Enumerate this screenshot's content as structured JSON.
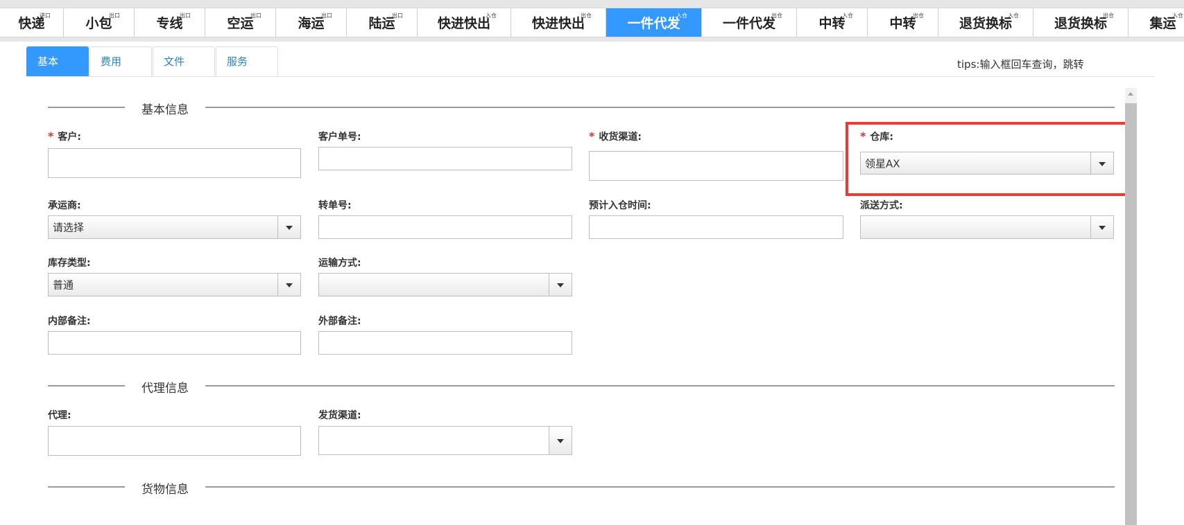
{
  "nav": [
    {
      "label": "快递",
      "sup": "进口",
      "active": false
    },
    {
      "label": "小包",
      "sup": "出口",
      "active": false
    },
    {
      "label": "专线",
      "sup": "出口",
      "active": false
    },
    {
      "label": "空运",
      "sup": "出口",
      "active": false
    },
    {
      "label": "海运",
      "sup": "出口",
      "active": false
    },
    {
      "label": "陆运",
      "sup": "出口",
      "active": false
    },
    {
      "label": "快进快出",
      "sup": "入仓",
      "active": false
    },
    {
      "label": "快进快出",
      "sup": "出仓",
      "active": false
    },
    {
      "label": "一件代发",
      "sup": "入仓",
      "active": true
    },
    {
      "label": "一件代发",
      "sup": "出仓",
      "active": false
    },
    {
      "label": "中转",
      "sup": "入仓",
      "active": false
    },
    {
      "label": "中转",
      "sup": "出仓",
      "active": false
    },
    {
      "label": "退货换标",
      "sup": "入仓",
      "active": false
    },
    {
      "label": "退货换标",
      "sup": "出仓",
      "active": false
    },
    {
      "label": "集运",
      "sup": "入仓",
      "active": false
    }
  ],
  "tabs": [
    {
      "label": "基本",
      "active": true
    },
    {
      "label": "费用",
      "active": false
    },
    {
      "label": "文件",
      "active": false
    },
    {
      "label": "服务",
      "active": false
    }
  ],
  "tips": "tips:输入框回车查询，跳转",
  "sections": {
    "basic": "基本信息",
    "agent": "代理信息",
    "cargo": "货物信息"
  },
  "form": {
    "required_mark": "*",
    "customer": {
      "label": "客户:",
      "value": ""
    },
    "customer_no": {
      "label": "客户单号:",
      "value": ""
    },
    "receive_channel": {
      "label": "收货渠道:",
      "value": ""
    },
    "warehouse": {
      "label": "仓库:",
      "value": "领星AX"
    },
    "carrier": {
      "label": "承运商:",
      "value": "请选择"
    },
    "transfer_no": {
      "label": "转单号:",
      "value": ""
    },
    "eta": {
      "label": "预计入仓时间:",
      "value": ""
    },
    "delivery_method": {
      "label": "派送方式:",
      "value": ""
    },
    "stock_type": {
      "label": "库存类型:",
      "value": "普通"
    },
    "transport_mode": {
      "label": "运输方式:",
      "value": ""
    },
    "internal_note": {
      "label": "内部备注:",
      "value": ""
    },
    "external_note": {
      "label": "外部备注:",
      "value": ""
    },
    "agent": {
      "label": "代理:",
      "value": ""
    },
    "ship_channel": {
      "label": "发货渠道:",
      "value": ""
    }
  },
  "colors": {
    "accent": "#3399ff",
    "highlight": "#ec3a3a",
    "required": "#e03030"
  }
}
